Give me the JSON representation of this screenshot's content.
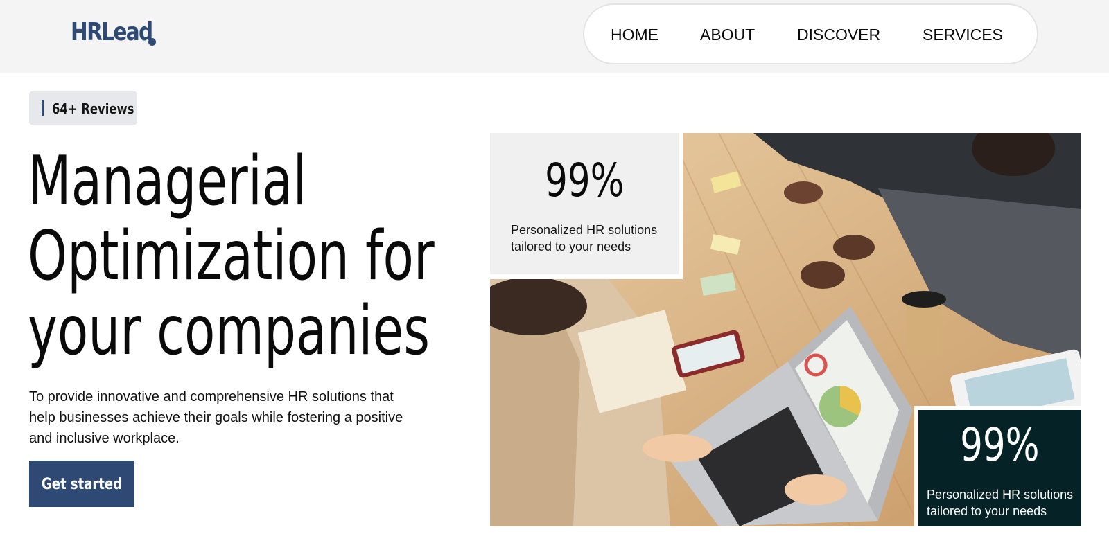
{
  "brand": {
    "logo_text": "HRLead",
    "accent_color": "#2e4a74",
    "dark_card_color": "#052226"
  },
  "nav": {
    "items": [
      {
        "label": "HOME"
      },
      {
        "label": "ABOUT"
      },
      {
        "label": "DISCOVER"
      },
      {
        "label": "SERVICES"
      }
    ]
  },
  "hero": {
    "badge": "64+ Reviews",
    "headline_lines": [
      "Managerial",
      "Optimization for",
      "your companies"
    ],
    "description": "To provide innovative and comprehensive HR solutions that help businesses achieve their goals while fostering a positive and inclusive workplace.",
    "cta_label": "Get started"
  },
  "stats": [
    {
      "value": "99%",
      "label": "Personalized HR solutions tailored to your needs"
    },
    {
      "value": "99%",
      "label": "Personalized HR solutions tailored to your needs"
    }
  ],
  "image": {
    "description_icon": "team-meeting-photo"
  }
}
